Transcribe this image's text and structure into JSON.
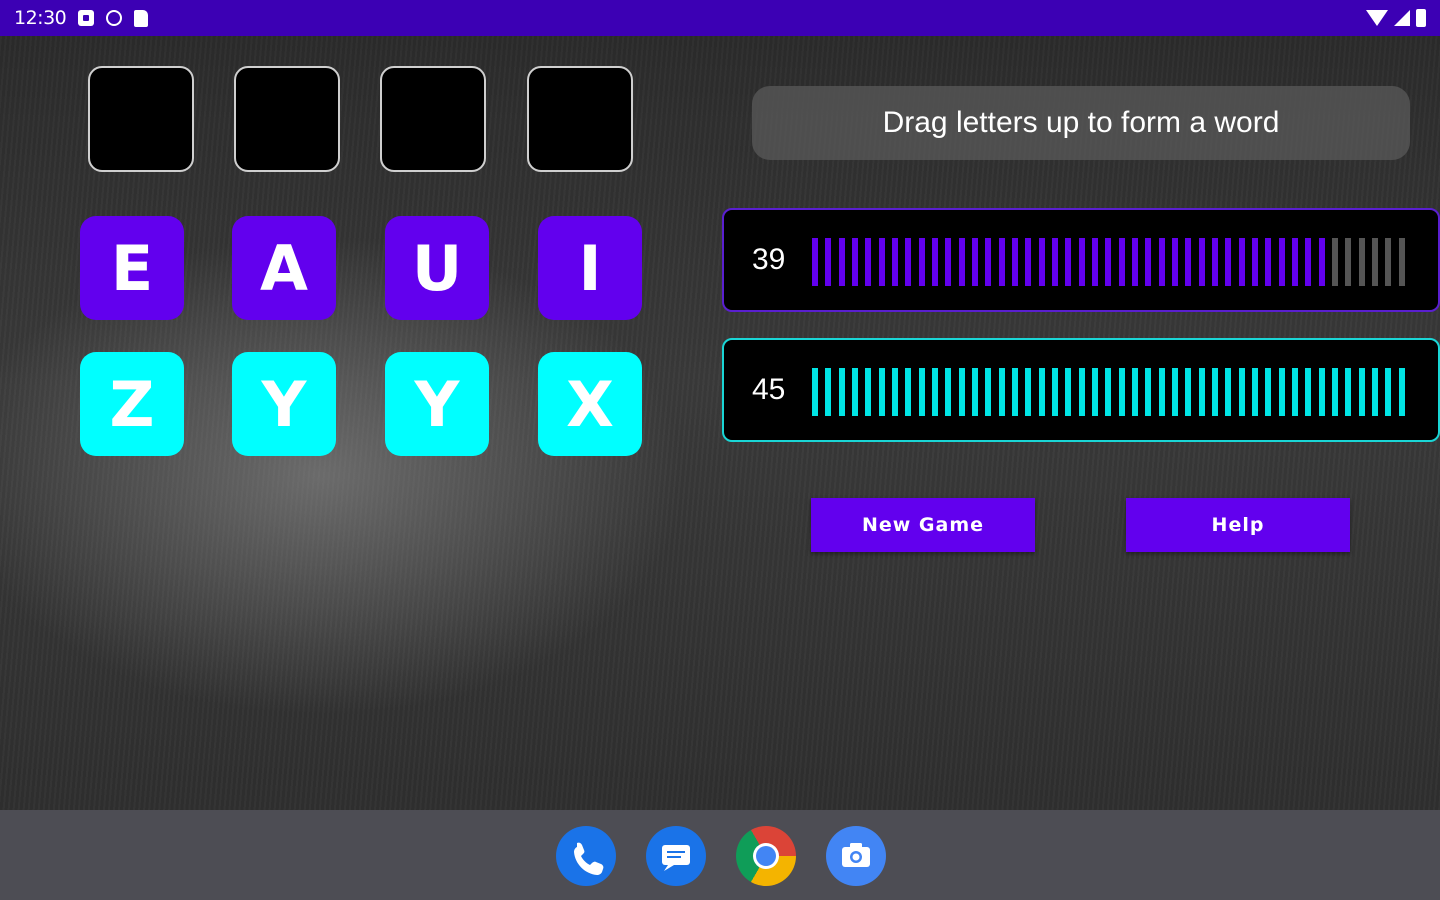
{
  "status_bar": {
    "time": "12:30",
    "left_icons": [
      "notification-icon",
      "sync-icon",
      "sd-card-icon"
    ],
    "right_icons": [
      "wifi-icon",
      "cell-signal-icon",
      "battery-icon"
    ],
    "color": "#3c00b4"
  },
  "game": {
    "answer_slots": [
      "",
      "",
      "",
      ""
    ],
    "vowel_tiles": [
      "E",
      "A",
      "U",
      "I"
    ],
    "consonant_tiles": [
      "Z",
      "Y",
      "Y",
      "X"
    ],
    "hint": "Drag letters up to form a word",
    "vowel_meter": {
      "value": "39",
      "total_bars": 45,
      "filled_bars": 39,
      "fill_color": "#6200ee",
      "empty_color": "#555555"
    },
    "consonant_meter": {
      "value": "45",
      "total_bars": 45,
      "filled_bars": 45,
      "fill_color": "#00e5e5",
      "empty_color": "#555555"
    },
    "buttons": {
      "new_game": "New Game",
      "help": "Help"
    },
    "colors": {
      "vowel": "#6200ee",
      "consonant": "#00ffff",
      "accent": "#6200ee"
    }
  },
  "dock": {
    "apps": [
      "phone-icon",
      "messages-icon",
      "chrome-icon",
      "camera-icon"
    ]
  }
}
